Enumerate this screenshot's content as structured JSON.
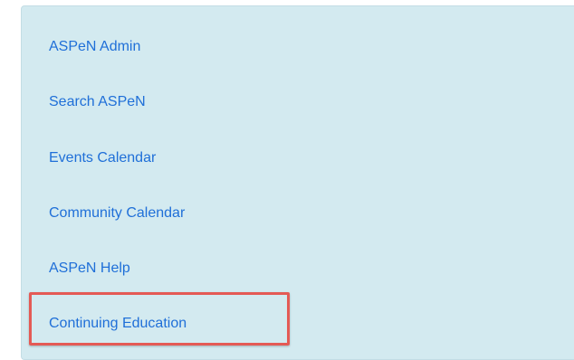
{
  "sidebar": {
    "items": [
      {
        "label": "ASPeN Admin"
      },
      {
        "label": "Search ASPeN"
      },
      {
        "label": "Events Calendar"
      },
      {
        "label": "Community Calendar"
      },
      {
        "label": "ASPeN Help"
      },
      {
        "label": "Continuing Education"
      }
    ],
    "highlighted_item": "Continuing Education"
  },
  "colors": {
    "panel_background": "#d3eaf0",
    "link": "#1f6fd8",
    "highlight_border": "#e45a55"
  }
}
